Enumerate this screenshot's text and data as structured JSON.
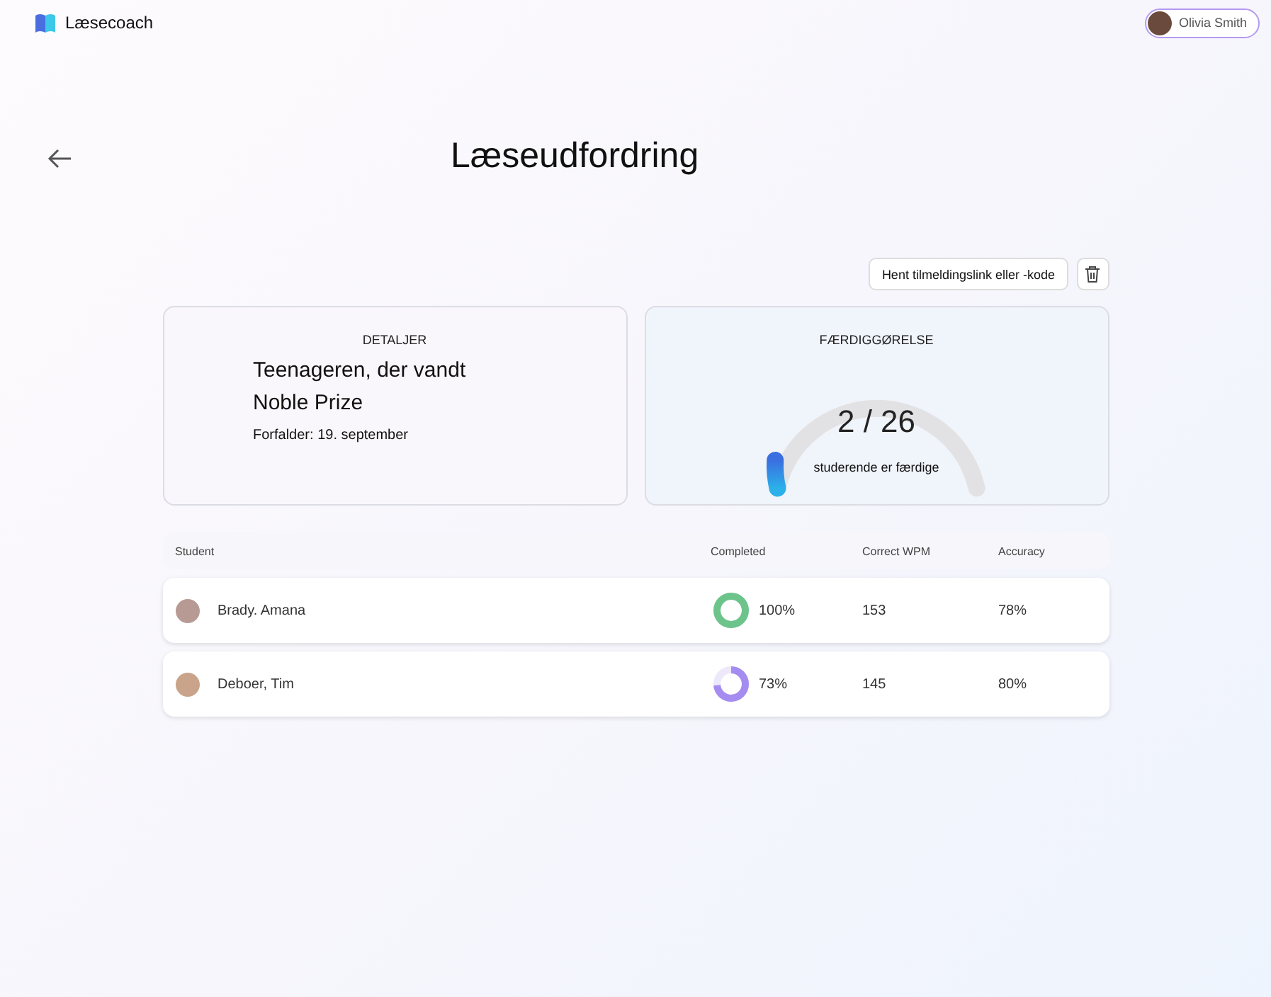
{
  "app": {
    "name": "Læsecoach"
  },
  "user": {
    "name": "Olivia Smith"
  },
  "page": {
    "title": "Læseudfordring"
  },
  "actions": {
    "link_button": "Hent tilmeldingslink eller -kode"
  },
  "details": {
    "heading": "DETALJER",
    "title_line_1": "Teenageren, der vandt",
    "title_line_2": "Noble Prize",
    "due": "Forfalder: 19. september"
  },
  "completion": {
    "heading": "FÆRDIGGØRELSE",
    "count": "2 / 26",
    "caption": "studerende er færdige",
    "level": 0.077
  },
  "table": {
    "columns": [
      "Student",
      "Completed",
      "Correct WPM",
      "Accuracy"
    ],
    "rows": [
      {
        "name": "Brady. Amana",
        "completed": "100%",
        "level": 1.0,
        "color": "#6cc48a",
        "wpm": "153",
        "accuracy": "78%"
      },
      {
        "name": "Deboer, Tim",
        "completed": "73%",
        "level": 0.73,
        "color": "#a48cf0",
        "wpm": "145",
        "accuracy": "80%"
      }
    ]
  }
}
